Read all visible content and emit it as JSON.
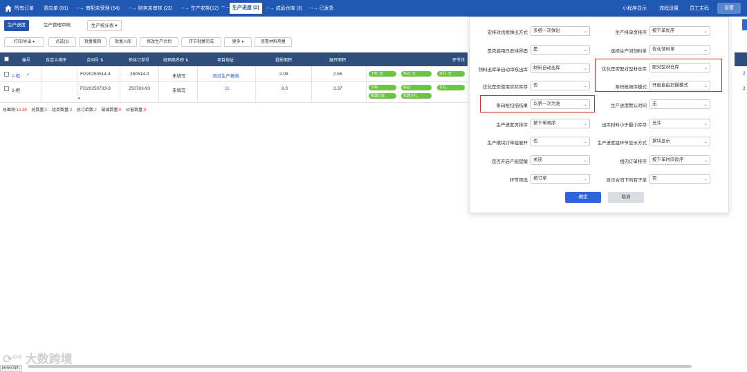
{
  "topnav": {
    "items": [
      "所有订单",
      "意向单 (81)",
      "--→ 审配未受理 (64)",
      "--→ 财务未审核 (23)",
      "--→ 生产安排(12)",
      "--→",
      "生产进度 (2)",
      "--→ 成品仓库 (3)",
      "--→ 已发货"
    ],
    "right": [
      "小程序显示",
      "流程设置",
      "员工主码"
    ],
    "settings_btn": "设置"
  },
  "tabs": {
    "t1": "生产进度",
    "t2": "生产管理审核",
    "t3": "生产统计表 ▾"
  },
  "toolbar": [
    "打印/导出 ▾",
    "点选(3)",
    "批量撤回",
    "批量入库",
    "修改生产计划",
    "环节批量完成",
    "更多 ▾",
    "查看材料用量"
  ],
  "table": {
    "headers": [
      "编号",
      "自定义排序",
      "合同号 ⇅",
      "柜体订单号",
      "经销商名称 ⇅",
      "项目地址",
      "投影面积",
      "展开面积",
      "环节详"
    ],
    "rows": [
      {
        "no": "1-柜",
        "check": "✓",
        "contract": "FG20250514-4",
        "order": "250514-3",
        "dealer": "未填写",
        "address": "测试生产报表",
        "proj": "2.08",
        "expand": "2.56",
        "pills": [
          "下料: 无",
          "封边: 无",
          "打孔: 无"
        ]
      },
      {
        "no": "2-柜",
        "contract": "FG20250703-3",
        "order": "250703-93",
        "dealer": "未填写",
        "address": "11",
        "proj": "8.3",
        "expand": "3.37",
        "pills": [
          "下料:",
          "封边:",
          "打孔:"
        ],
        "pills2": [
          "机器分拣:",
          "机器打孔:"
        ]
      }
    ],
    "right_digits": [
      "2",
      "2"
    ]
  },
  "summary": {
    "area_label": "总面积:",
    "area": "10.38",
    "total_label": "总数量:",
    "total": "2",
    "group_label": "组单数量:",
    "group": "2",
    "orders_label": "总订单数:",
    "orders": "2",
    "glass_label": "玻璃数量:",
    "glass": "0",
    "window_label": "纱窗数量:",
    "window": "0"
  },
  "settings": {
    "left": [
      {
        "label": "安排对话框弹出方式",
        "value": "多组一次弹出"
      },
      {
        "label": "是否启用已安排界面",
        "value": "是"
      },
      {
        "label": "领料出库单自动审核出库",
        "value": "材料自动出库"
      },
      {
        "label": "优化是否使用实际库存",
        "value": "否"
      },
      {
        "label": "条码枪扫描结果",
        "value": "以第一次为准"
      },
      {
        "label": "生产进度页排序",
        "value": "按下单顺序"
      },
      {
        "label": "生产模块订单组展开",
        "value": "否"
      },
      {
        "label": "是否开启产能提醒",
        "value": "关闭"
      },
      {
        "label": "环节筛选",
        "value": "按订单"
      }
    ],
    "right": [
      {
        "label": "生产排单页排序",
        "value": "按下单反序"
      },
      {
        "label": "选择生产间领料单",
        "value": "优化领料单"
      },
      {
        "label": "优化是否配对型材仓库",
        "value": "配对型材仓库"
      },
      {
        "label": "条码枪顺序模式",
        "value": "开启自由扫描模式"
      },
      {
        "label": "生产进度默认时间",
        "value": "无"
      },
      {
        "label": "出库材料小于最小库存",
        "value": "允许"
      },
      {
        "label": "生产进度组环节显示方式",
        "value": "按块显示"
      },
      {
        "label": "组内订单排序",
        "value": "按下单时间反序"
      },
      {
        "label": "显示合同下所有子单",
        "value": "否"
      }
    ],
    "ok": "确定",
    "cancel": "取消"
  },
  "status": "javascript:;",
  "watermark": "大数跨境"
}
